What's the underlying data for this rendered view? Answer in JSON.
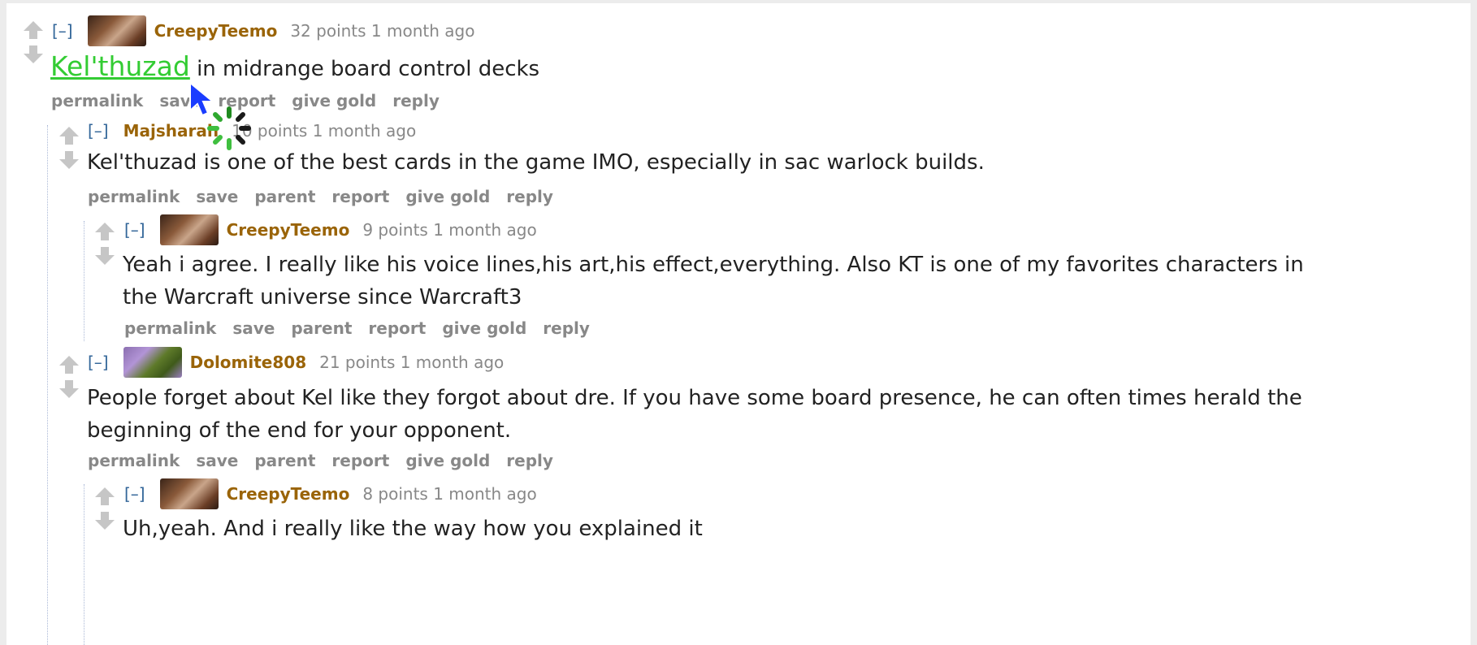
{
  "comments": [
    {
      "collapse": "[–]",
      "author": "CreepyTeemo",
      "score": "32 points",
      "age": "1 month ago",
      "body_link": "Kel'thuzad",
      "body_rest": " in midrange board control decks",
      "buttons": [
        "permalink",
        "save",
        "report",
        "give gold",
        "reply"
      ]
    },
    {
      "collapse": "[–]",
      "author": "Majsharah",
      "score": "10 points",
      "age": "1 month ago",
      "body_lines": [
        "Kel'thuzad is one of the best cards in the game IMO, especially in sac warlock builds."
      ],
      "buttons": [
        "permalink",
        "save",
        "parent",
        "report",
        "give gold",
        "reply"
      ]
    },
    {
      "collapse": "[–]",
      "author": "CreepyTeemo",
      "score": "9 points",
      "age": "1 month ago",
      "body_lines": [
        "Yeah i agree. I really like his voice lines,his art,his effect,everything. Also KT is one of my favorites characters in",
        "the Warcraft universe since Warcraft3"
      ],
      "buttons": [
        "permalink",
        "save",
        "parent",
        "report",
        "give gold",
        "reply"
      ]
    },
    {
      "collapse": "[–]",
      "author": "Dolomite808",
      "score": "21 points",
      "age": "1 month ago",
      "body_lines": [
        "People forget about Kel like they forgot about dre. If you have some board presence, he can often times herald the",
        "beginning of the end for your opponent."
      ],
      "buttons": [
        "permalink",
        "save",
        "parent",
        "report",
        "give gold",
        "reply"
      ]
    },
    {
      "collapse": "[–]",
      "author": "CreepyTeemo",
      "score": "8 points",
      "age": "1 month ago",
      "body_lines": [
        "Uh,yeah. And i really like the way how you explained it"
      ]
    }
  ],
  "colors": {
    "author": "#9a6408",
    "link": "#33cc33",
    "collapse": "#336699",
    "meta": "#888888"
  }
}
